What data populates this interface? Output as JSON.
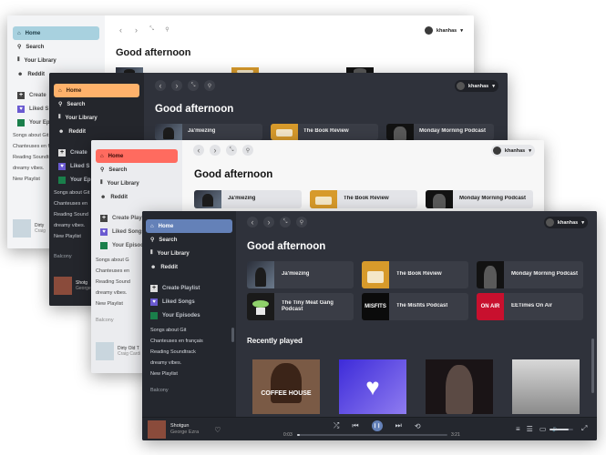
{
  "user": {
    "name": "khanhas",
    "caret": "▾"
  },
  "nav": {
    "home": "Home",
    "search": "Search",
    "library": "Your Library",
    "reddit": "Reddit"
  },
  "actions": {
    "create": "Create Playlist",
    "liked": "Liked Songs",
    "episodes": "Your Episodes"
  },
  "short": {
    "create": "Create",
    "liked_trunc": "Liked S",
    "episodes_trunc": "Your Ep",
    "create_trunc": "Create Playlis",
    "liked_mid": "Liked Songs",
    "episodes_mid": "Your Episodes"
  },
  "playlists": [
    "Songs about Git",
    "Chanteuses en français",
    "Reading Soundtrack",
    "dreamy vibes.",
    "New Playlist",
    "Balcony"
  ],
  "playlists_trunc": [
    "Songs about Git",
    "Chanteuses en",
    "Reading Sound",
    "dreamy vibes.",
    "New Playlist"
  ],
  "playlists_trunc2": [
    "Songs about G",
    "Chanteuses en",
    "Reading Sound",
    "dreamy vibes.",
    "New Playlist",
    "Balcony"
  ],
  "greeting": "Good afternoon",
  "shortcuts": [
    "Ja'miezing",
    "The Book Review",
    "Monday Morning Podcast",
    "The Tiny Meat Gang Podcast",
    "The Misfits Podcast",
    "EETimes On Air"
  ],
  "thumb_text": {
    "misfits": "MISFITS",
    "eetimes": "ON AIR",
    "coffee": "COFFEE HOUSE"
  },
  "recently": "Recently played",
  "now_playing": [
    {
      "title": "Dirty Old T",
      "artist": "Craig Cardiff"
    },
    {
      "title": "Shotgun",
      "artist": "George Ezra"
    },
    {
      "title": "Dirty Old T",
      "artist": "Craig Cardi"
    },
    {
      "title": "Shotgun",
      "artist": "George Ezra"
    }
  ],
  "short_np": [
    {
      "title": "Dirty",
      "artist": "Craig"
    },
    {
      "title": "Shotg",
      "artist": "George"
    }
  ],
  "player": {
    "elapsed": "0:03",
    "duration": "3:21",
    "progress": 0.02,
    "volume": 0.8
  },
  "colors": {
    "w1_accent": "#a8d1df",
    "w2_accent": "#ffb26b",
    "w3_accent": "#ff6b5f",
    "w4_accent": "#6481b8"
  },
  "icons": {
    "home": "⌂",
    "search": "⚲",
    "library": "⫴",
    "reddit": "☻",
    "plus": "+",
    "heart": "♥",
    "back": "‹",
    "forward": "›",
    "collapse": "⤡",
    "pin": "⚲",
    "shuffle": "⤮",
    "prev": "⏮",
    "pause": "❙❙",
    "next": "⏭",
    "repeat": "⟲",
    "lyrics": "≡",
    "queue": "☰",
    "device": "▭",
    "volume": "🔈",
    "expand": "⤢",
    "like": "♡"
  }
}
